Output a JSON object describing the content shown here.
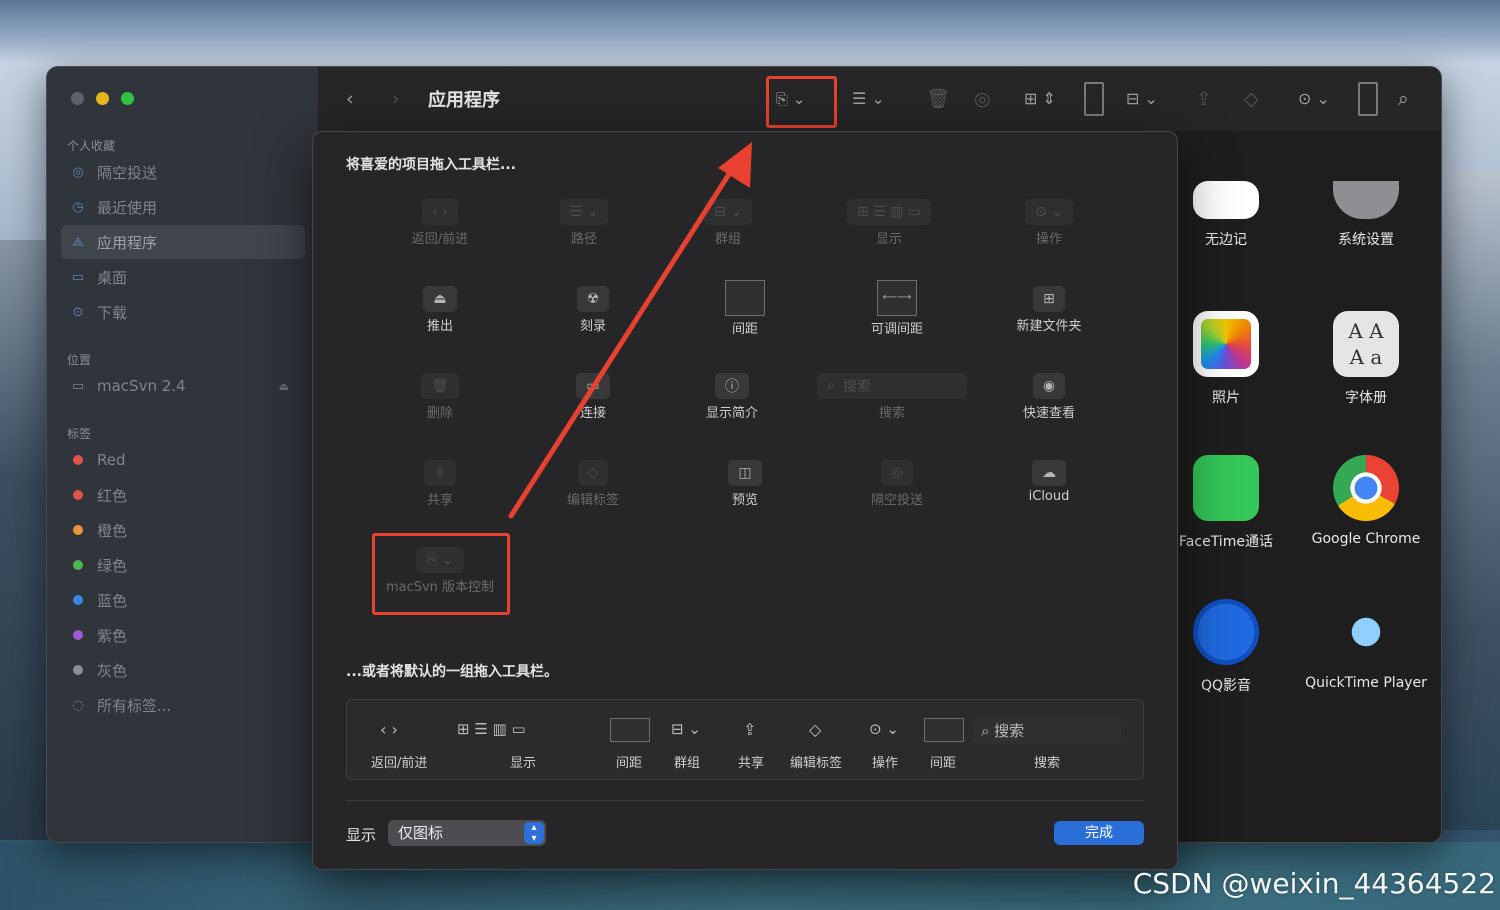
{
  "window": {
    "title": "应用程序"
  },
  "sidebar": {
    "favorites_header": "个人收藏",
    "favorites": [
      {
        "label": "隔空投送",
        "icon": "airdrop-icon"
      },
      {
        "label": "最近使用",
        "icon": "clock-icon"
      },
      {
        "label": "应用程序",
        "icon": "applications-icon",
        "selected": true
      },
      {
        "label": "桌面",
        "icon": "desktop-icon"
      },
      {
        "label": "下载",
        "icon": "download-icon"
      }
    ],
    "locations_header": "位置",
    "locations": [
      {
        "label": "macSvn 2.4",
        "icon": "disk-icon"
      }
    ],
    "tags_header": "标签",
    "tags": [
      {
        "label": "Red",
        "color": "#e0524c"
      },
      {
        "label": "红色",
        "color": "#e0524c"
      },
      {
        "label": "橙色",
        "color": "#e8963a"
      },
      {
        "label": "绿色",
        "color": "#4fb34f"
      },
      {
        "label": "蓝色",
        "color": "#3a86e8"
      },
      {
        "label": "紫色",
        "color": "#9a5cd0"
      },
      {
        "label": "灰色",
        "color": "#8d8d92"
      }
    ],
    "all_tags": "所有标签..."
  },
  "apps": [
    {
      "label": "无边记"
    },
    {
      "label": "系统设置"
    },
    {
      "label": "照片"
    },
    {
      "label": "字体册"
    },
    {
      "label": "FaceTime通话"
    },
    {
      "label": "Google Chrome"
    },
    {
      "label": "QQ影音"
    },
    {
      "label": "QuickTime Player"
    }
  ],
  "sheet": {
    "header_top": "将喜爱的项目拖入工具栏...",
    "items": [
      {
        "label": "返回/前进",
        "dim": true
      },
      {
        "label": "路径",
        "dim": true
      },
      {
        "label": "群组",
        "dim": true
      },
      {
        "label": "显示",
        "dim": true
      },
      {
        "label": "操作",
        "dim": true
      },
      {
        "label": "推出"
      },
      {
        "label": "刻录"
      },
      {
        "label": "间距"
      },
      {
        "label": "可调间距"
      },
      {
        "label": "新建文件夹"
      },
      {
        "label": "删除",
        "dim": true
      },
      {
        "label": "连接"
      },
      {
        "label": "显示简介"
      },
      {
        "label": "搜索",
        "dim": true
      },
      {
        "label": "快速查看"
      },
      {
        "label": "共享",
        "dim": true
      },
      {
        "label": "编辑标签",
        "dim": true
      },
      {
        "label": "预览"
      },
      {
        "label": "隔空投送",
        "dim": true
      },
      {
        "label": "iCloud"
      },
      {
        "label": "macSvn 版本控制",
        "dim": true
      }
    ],
    "search_placeholder": "搜索",
    "header_default": "...或者将默认的一组拖入工具栏。",
    "default_set": [
      "返回/前进",
      "显示",
      "间距",
      "群组",
      "共享",
      "编辑标签",
      "操作",
      "间距",
      "搜索"
    ],
    "default_search_placeholder": "搜索",
    "show_label": "显示",
    "show_value": "仅图标",
    "done": "完成"
  },
  "watermark": "CSDN @weixin_44364522",
  "colors": {
    "highlight": "#e8412f",
    "accent": "#2a6fd8"
  }
}
